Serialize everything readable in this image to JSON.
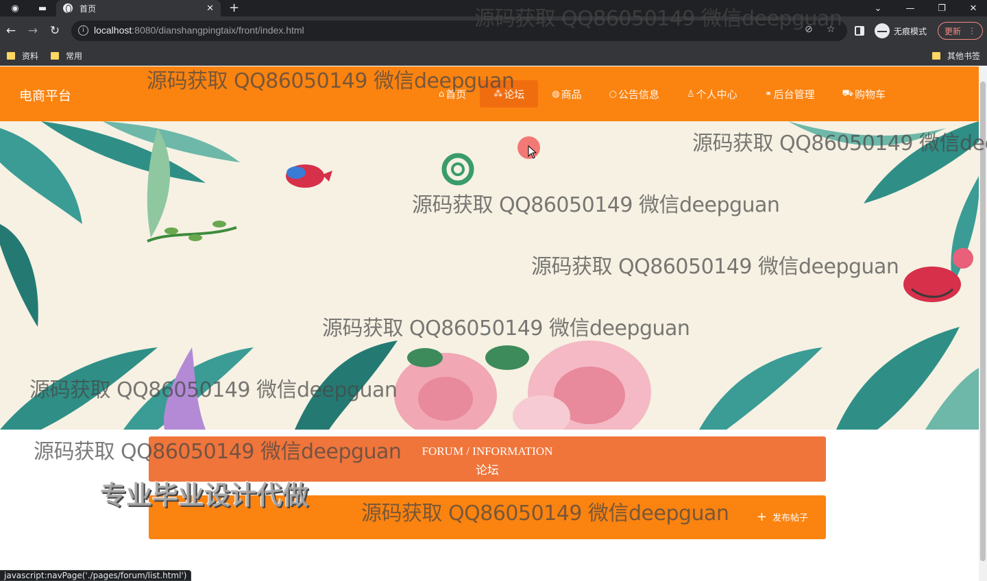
{
  "browser": {
    "tab_title": "首页",
    "url_host": "localhost",
    "url_rest": ":8080/dianshangpingtaix/front/index.html",
    "profile_label": "无痕模式",
    "update_label": "更新",
    "bookmarks": [
      "资料",
      "常用"
    ],
    "other_bookmarks": "其他书签",
    "status_url": "javascript:navPage('./pages/forum/list.html')"
  },
  "site": {
    "title": "电商平台",
    "nav": [
      {
        "label": "首页",
        "icon": "home-icon"
      },
      {
        "label": "论坛",
        "icon": "forum-icon"
      },
      {
        "label": "商品",
        "icon": "goods-icon"
      },
      {
        "label": "公告信息",
        "icon": "notice-icon"
      },
      {
        "label": "个人中心",
        "icon": "user-icon"
      },
      {
        "label": "后台管理",
        "icon": "link-icon"
      },
      {
        "label": "购物车",
        "icon": "cart-icon"
      }
    ],
    "active_nav": "论坛"
  },
  "carousel": {
    "slides": 3,
    "active_index": 0
  },
  "forum": {
    "header_en": "FORUM / INFORMATION",
    "header_cn": "论坛",
    "post_button": "发布帖子"
  },
  "overlay": {
    "watermark": "源码获取 QQ86050149 微信deepguan",
    "promo": "专业毕业设计代做"
  },
  "colors": {
    "brand": "#fb8310",
    "forum_header": "#f0753a"
  }
}
